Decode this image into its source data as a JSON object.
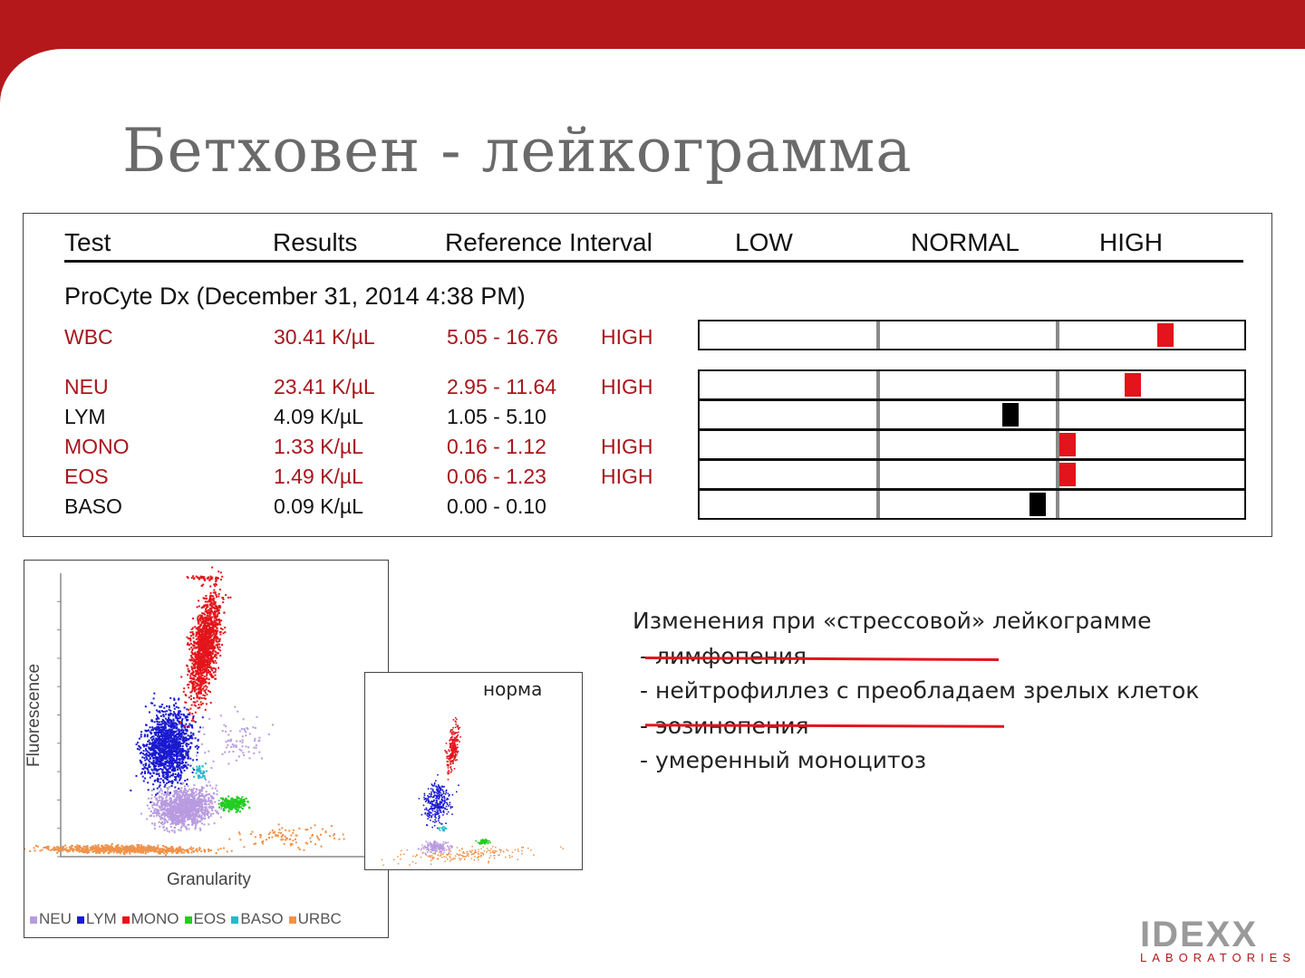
{
  "slide": {
    "title": "Бетховен - лейкограмма",
    "accent_color": "#b5181b"
  },
  "report": {
    "headers": {
      "test": "Test",
      "results": "Results",
      "reference": "Reference Interval",
      "low": "LOW",
      "normal": "NORMAL",
      "high": "HIGH"
    },
    "instrument": "ProCyte Dx (December 31, 2014 4:38 PM)",
    "rows": [
      {
        "test": "WBC",
        "result": "30.41 K/µL",
        "range": "5.05 - 16.76",
        "flag": "HIGH",
        "position": 0.855,
        "marker_color": "#e3141b"
      },
      {
        "test": "NEU",
        "result": "23.41 K/µL",
        "range": "2.95 - 11.64",
        "flag": "HIGH",
        "position": 0.795,
        "marker_color": "#e3141b"
      },
      {
        "test": "LYM",
        "result": "4.09 K/µL",
        "range": "1.05 - 5.10",
        "flag": "",
        "position": 0.57,
        "marker_color": "#000000"
      },
      {
        "test": "MONO",
        "result": "1.33 K/µL",
        "range": "0.16 - 1.12",
        "flag": "HIGH",
        "position": 0.675,
        "marker_color": "#e3141b"
      },
      {
        "test": "EOS",
        "result": "1.49 K/µL",
        "range": "0.06 - 1.23",
        "flag": "HIGH",
        "position": 0.675,
        "marker_color": "#e3141b"
      },
      {
        "test": "BASO",
        "result": "0.09 K/µL",
        "range": "0.00 - 0.10",
        "flag": "",
        "position": 0.62,
        "marker_color": "#000000"
      }
    ]
  },
  "scatter_main": {
    "xlabel": "Granularity",
    "ylabel": "Fluorescence",
    "legend": [
      {
        "label": "NEU",
        "color": "#b89be0"
      },
      {
        "label": "LYM",
        "color": "#1a1ad0"
      },
      {
        "label": "MONO",
        "color": "#e3141b"
      },
      {
        "label": "EOS",
        "color": "#22cc22"
      },
      {
        "label": "BASO",
        "color": "#22bbcc"
      },
      {
        "label": "URBC",
        "color": "#f0924a"
      }
    ]
  },
  "scatter_small": {
    "label": "норма"
  },
  "notes": {
    "heading": "Изменения при «стрессовой» лейкограмме",
    "items": [
      "- лимфопения",
      "- нейтрофиллез с преобладаем зрелых клеток",
      "- эозинопения",
      "- умеренный моноцитоз"
    ]
  },
  "logo": {
    "name": "IDEXX",
    "subtitle": "LABORATORIES"
  }
}
